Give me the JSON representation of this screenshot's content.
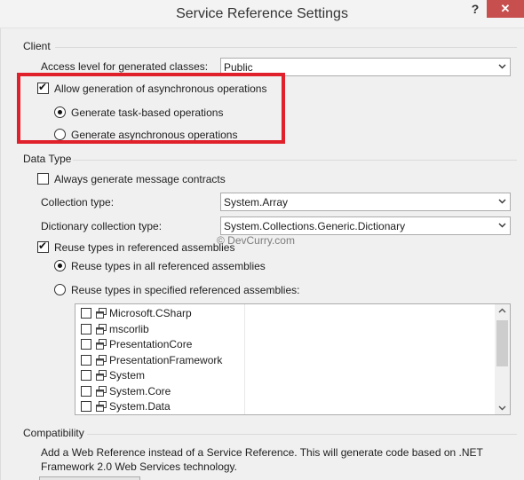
{
  "window": {
    "title": "Service Reference Settings",
    "help_glyph": "?",
    "close_glyph": "✕"
  },
  "client": {
    "group_label": "Client",
    "access_level_label": "Access level for generated classes:",
    "access_level_value": "Public",
    "allow_async_label": "Allow generation of asynchronous operations",
    "allow_async_checked": true,
    "task_based_label": "Generate task-based operations",
    "task_based_selected": true,
    "async_ops_label": "Generate asynchronous operations",
    "async_ops_selected": false
  },
  "data_type": {
    "group_label": "Data Type",
    "always_generate_label": "Always generate message contracts",
    "always_generate_checked": false,
    "collection_type_label": "Collection type:",
    "collection_type_value": "System.Array",
    "dictionary_type_label": "Dictionary collection type:",
    "dictionary_type_value": "System.Collections.Generic.Dictionary",
    "reuse_types_label": "Reuse types in referenced assemblies",
    "reuse_types_checked": true,
    "reuse_all_label": "Reuse types in all referenced assemblies",
    "reuse_all_selected": true,
    "reuse_specified_label": "Reuse types in specified referenced assemblies:",
    "reuse_specified_selected": false,
    "assemblies": [
      {
        "name": "Microsoft.CSharp",
        "checked": false
      },
      {
        "name": "mscorlib",
        "checked": false
      },
      {
        "name": "PresentationCore",
        "checked": false
      },
      {
        "name": "PresentationFramework",
        "checked": false
      },
      {
        "name": "System",
        "checked": false
      },
      {
        "name": "System.Core",
        "checked": false
      },
      {
        "name": "System.Data",
        "checked": false
      }
    ]
  },
  "compatibility": {
    "group_label": "Compatibility",
    "description": "Add a Web Reference instead of a Service Reference. This will generate code based on .NET Framework 2.0 Web Services technology."
  },
  "watermark": "© DevCurry.com",
  "colors": {
    "highlight_border": "#e0202a",
    "close_button": "#c7504f",
    "dialog_background": "#f0f0f0"
  },
  "icons": [
    "help-icon",
    "close-icon",
    "chevron-down-icon",
    "reference-icon",
    "scroll-up-icon",
    "scroll-down-icon"
  ]
}
